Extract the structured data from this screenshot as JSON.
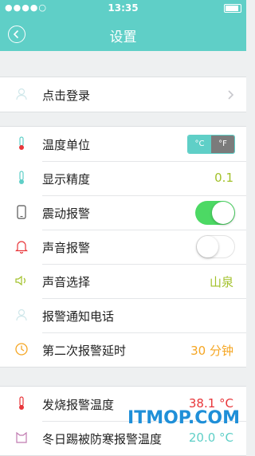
{
  "status": {
    "carrier": "●●●●○",
    "time": "13:35"
  },
  "header": {
    "title": "设置"
  },
  "account": {
    "login_label": "点击登录"
  },
  "settings": [
    {
      "label": "温度单位"
    },
    {
      "label": "显示精度",
      "value": "0.1"
    },
    {
      "label": "震动报警",
      "on": true
    },
    {
      "label": "声音报警",
      "on": false
    },
    {
      "label": "声音选择",
      "value": "山泉"
    },
    {
      "label": "报警通知电话"
    },
    {
      "label": "第二次报警延时",
      "value": "30 分钟"
    }
  ],
  "unit_toggle": {
    "c": "°C",
    "f": "°F",
    "selected": "°C"
  },
  "alerts": [
    {
      "label": "发烧报警温度",
      "value": "38.1 °C"
    },
    {
      "label": "冬日踢被防寒报警温度",
      "value": "20.0 °C"
    }
  ],
  "watermark": "ITMOP.COM",
  "colors": {
    "accent": "#5fcfc7",
    "green_value": "#a2c12a",
    "orange_value": "#f5a623",
    "red_value": "#e8363a"
  }
}
